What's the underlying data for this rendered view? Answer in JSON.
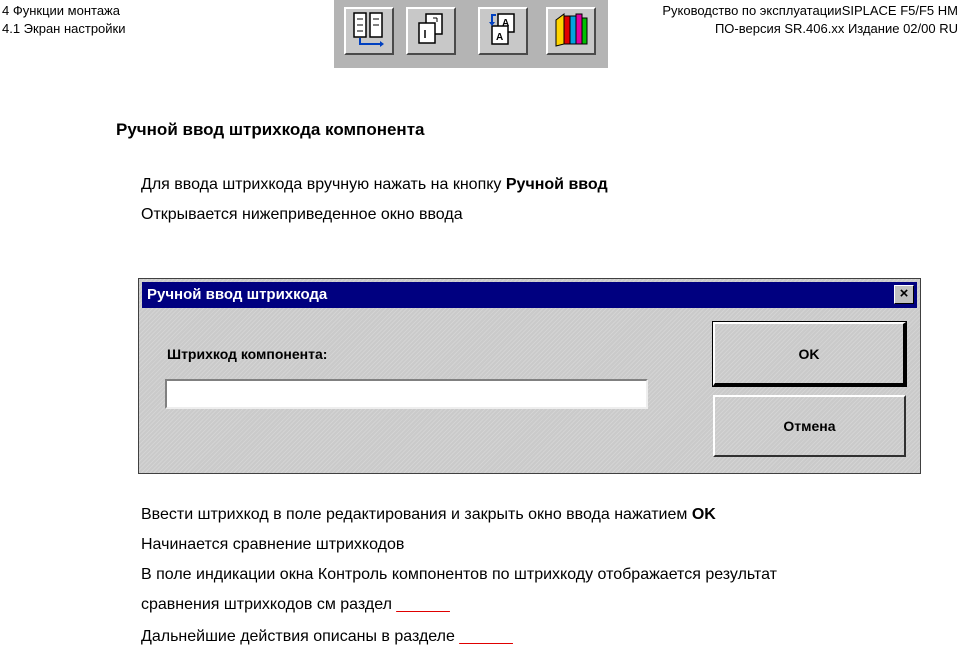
{
  "header": {
    "left_line1": "4 Функции монтажа",
    "left_line2": "4.1 Экран настройки",
    "right_line1": "Руководство по эксплуатацииSIPLACE F5/F5 HM",
    "right_line2": "ПО-версия SR.406.xx   Издание 02/00 RU"
  },
  "toolbar": {
    "icons": [
      "panel-layout-icon",
      "copy-pages-icon",
      "document-transfer-icon",
      "books-icon"
    ]
  },
  "section_title": "Ручной ввод штрихкода компонента",
  "intro": {
    "line1_text": "Для ввода штрихкода вручную нажать на кнопку ",
    "line1_bold": "Ручной ввод",
    "line2": "Открывается нижеприведенное окно ввода"
  },
  "dialog": {
    "title": "Ручной ввод штрихкода",
    "close_label": "×",
    "field_label": "Штрихкод компонента:",
    "field_value": "",
    "ok_label": "OK",
    "cancel_label": "Отмена"
  },
  "body": {
    "p1_text": "Ввести штрихкод в поле редактирования и закрыть окно ввода нажатием ",
    "p1_bold": "OK",
    "p2": "Начинается сравнение штрихкодов",
    "p3": "В поле индикации окна   Контроль компонентов по штрихкоду  отображается результат",
    "p4_text": "сравнения штрихкодов  см  раздел ",
    "p4_link": "______",
    "p5_text": "Дальнейшие действия описаны в разделе ",
    "p5_link": "______"
  },
  "colors": {
    "titlebar": "#000080",
    "link_placeholder": "#e00000",
    "dialog_bg": "#cacaca"
  }
}
